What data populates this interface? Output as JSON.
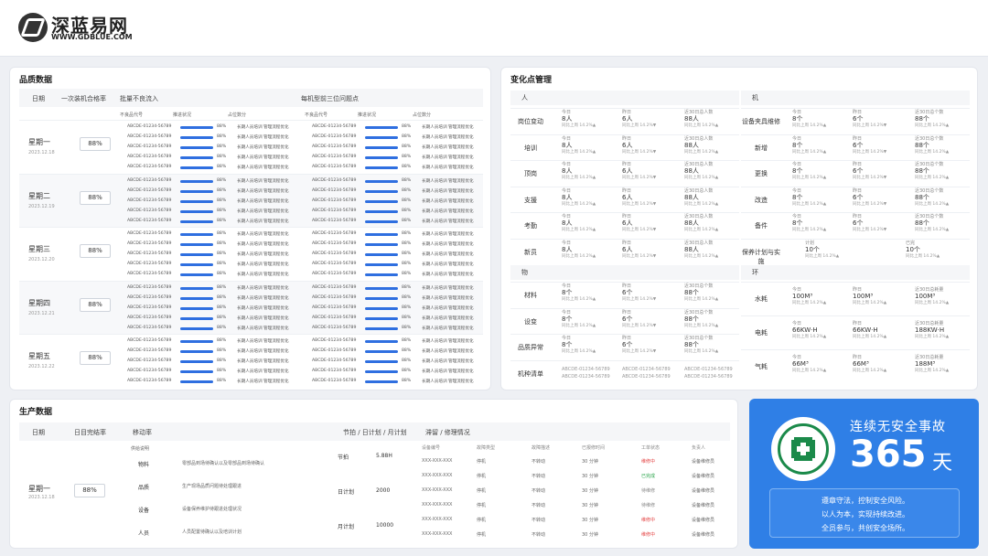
{
  "brand": {
    "name": "深蓝易网",
    "url": "WWW.GDBLUE.COM"
  },
  "quality": {
    "title": "品质数据",
    "headers": {
      "date": "日期",
      "rate": "一次装机合格率",
      "batch": "批量不良流入",
      "top": "每机型前三位问题点"
    },
    "sub_headers": {
      "part": "不良品代号",
      "progress": "推进状况",
      "issue": "占位数分"
    },
    "part_code": "ABCDE-01234-56789",
    "pct": "88%",
    "issue_text": "长期人员培训 管理流程优化",
    "rows": [
      {
        "day": "星期一",
        "date": "2023.12.18",
        "rate": "88%"
      },
      {
        "day": "星期二",
        "date": "2023.12.19",
        "rate": "88%"
      },
      {
        "day": "星期三",
        "date": "2023.12.20",
        "rate": "88%"
      },
      {
        "day": "星期四",
        "date": "2023.12.21",
        "rate": "88%"
      },
      {
        "day": "星期五",
        "date": "2023.12.22",
        "rate": "88%"
      }
    ]
  },
  "changes": {
    "title": "变化点管理",
    "person": {
      "label": "人",
      "rows": [
        {
          "name": "岗位变动"
        },
        {
          "name": "培训"
        },
        {
          "name": "顶岗"
        },
        {
          "name": "支援"
        },
        {
          "name": "考勤"
        },
        {
          "name": "新员"
        }
      ],
      "today": "今日",
      "today_v": "8人",
      "yesterday": "昨日",
      "yesterday_v": "6人",
      "month": "近30日总人数",
      "month_v": "88人",
      "cmp_a": "同比上周 14.2%▲",
      "cmp_b": "同比上周 14.2%▼"
    },
    "machine": {
      "label": "机",
      "rows": [
        {
          "name": "设备夹具维修"
        },
        {
          "name": "新增"
        },
        {
          "name": "更换"
        },
        {
          "name": "改造"
        },
        {
          "name": "备件"
        },
        {
          "name": "保养计划与实施"
        }
      ],
      "today": "今日",
      "today_v": "8个",
      "yesterday": "昨日",
      "yesterday_v": "6个",
      "month": "近30日总个数",
      "month_v": "88个",
      "plan": "计划",
      "plan_v": "10个",
      "done": "已完",
      "done_v": "10个"
    },
    "material": {
      "label": "物",
      "rows": [
        {
          "name": "材料"
        },
        {
          "name": "设变"
        },
        {
          "name": "品质异常"
        },
        {
          "name": "机种清单"
        }
      ],
      "code": "ABCDE-01234-56789"
    },
    "env": {
      "label": "环",
      "rows": [
        {
          "name": "水耗",
          "today": "100M³",
          "yesterday": "100M³",
          "month": "100M³"
        },
        {
          "name": "电耗",
          "today": "66KW·H",
          "yesterday": "66KW·H",
          "month": "188KW·H"
        },
        {
          "name": "气耗",
          "today": "66M³",
          "yesterday": "66M³",
          "month": "188M³"
        }
      ],
      "month": "近30日总耗量"
    }
  },
  "production": {
    "title": "生产数据",
    "headers": {
      "date": "日期",
      "rate": "日目完结率",
      "change": "移动率",
      "plan": "节拍 / 日计划 / 月计划",
      "maint": "滞留 / 修理情况"
    },
    "day": "星期一",
    "date": "2023.12.18",
    "rate": "88%",
    "sub_label": "供给说明",
    "items": [
      {
        "name": "物料",
        "text": "零部品到场待确认以及零部品到场待确认"
      },
      {
        "name": "品质",
        "text": "生产现场品质问题待处理跟进"
      },
      {
        "name": "设备",
        "text": "设备保养维护待跟进处理状况"
      },
      {
        "name": "人员",
        "text": "人员配置待确认以及培训计划"
      }
    ],
    "plan_rows": [
      {
        "label": "节拍",
        "value": "5.88H"
      },
      {
        "label": "日计划",
        "value": "2000"
      },
      {
        "label": "月计划",
        "value": "10000"
      }
    ],
    "maint_headers": [
      "设备编号",
      "故障类型",
      "故障描述",
      "已报修时间",
      "工单状态",
      "负责人"
    ],
    "maint_rows": [
      {
        "id": "XXX-XXX-XXX",
        "type": "停机",
        "desc": "不转动",
        "time": "30 分钟",
        "status": "维修中",
        "state": "red",
        "owner": "设备维修员"
      },
      {
        "id": "XXX-XXX-XXX",
        "type": "停机",
        "desc": "不转动",
        "time": "30 分钟",
        "status": "已完成",
        "state": "green",
        "owner": "设备维修员"
      },
      {
        "id": "XXX-XXX-XXX",
        "type": "停机",
        "desc": "不转动",
        "time": "30 分钟",
        "status": "待维修",
        "state": "gray",
        "owner": "设备维修员"
      },
      {
        "id": "XXX-XXX-XXX",
        "type": "停机",
        "desc": "不转动",
        "time": "30 分钟",
        "status": "待维修",
        "state": "gray",
        "owner": "设备维修员"
      },
      {
        "id": "XXX-XXX-XXX",
        "type": "停机",
        "desc": "不转动",
        "time": "30 分钟",
        "status": "维修中",
        "state": "red",
        "owner": "设备维修员"
      },
      {
        "id": "XXX-XXX-XXX",
        "type": "停机",
        "desc": "不转动",
        "time": "30 分钟",
        "status": "维修中",
        "state": "red",
        "owner": "设备维修员"
      }
    ]
  },
  "safety": {
    "title": "连续无安全事故",
    "days": "365",
    "unit": "天",
    "slogans": [
      "遵章守法，控制安全风险。",
      "以人为本，实现持续改进。",
      "全员参与，共创安全场所。"
    ]
  },
  "colors": {
    "accent": "#2f6fe0",
    "safety_bg": "#2f7fe6",
    "up": "#e44444",
    "down": "#2aa44a"
  }
}
